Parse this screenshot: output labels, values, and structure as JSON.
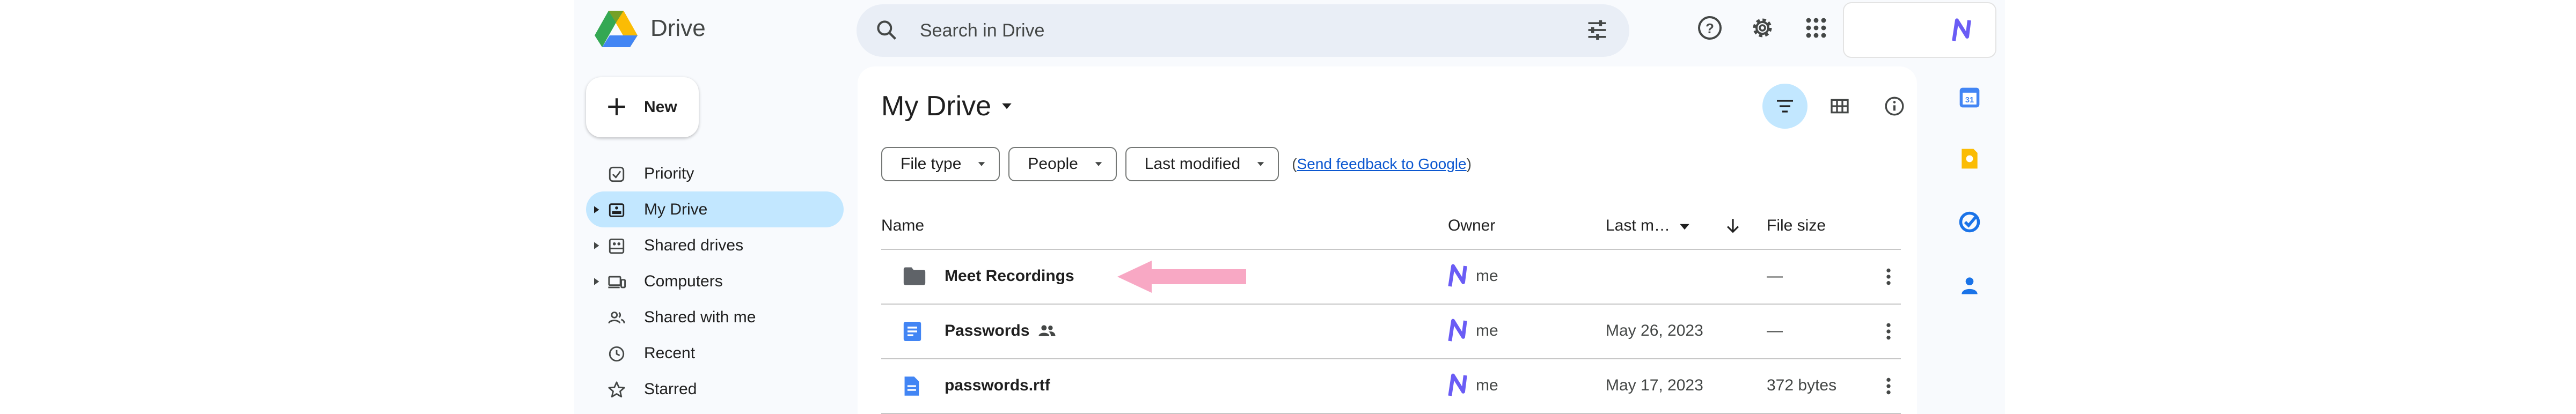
{
  "app": {
    "title": "Drive"
  },
  "search": {
    "placeholder": "Search in Drive"
  },
  "sidebar": {
    "new_label": "New",
    "items": [
      {
        "label": "Priority"
      },
      {
        "label": "My Drive"
      },
      {
        "label": "Shared drives"
      },
      {
        "label": "Computers"
      },
      {
        "label": "Shared with me"
      },
      {
        "label": "Recent"
      },
      {
        "label": "Starred"
      }
    ]
  },
  "main": {
    "title": "My Drive",
    "filters": [
      {
        "label": "File type"
      },
      {
        "label": "People"
      },
      {
        "label": "Last modified"
      }
    ],
    "feedback": {
      "open": "(",
      "link": "Send feedback to Google",
      "close": ")"
    },
    "columns": {
      "name": "Name",
      "owner": "Owner",
      "modified": "Last m…",
      "size": "File size"
    },
    "rows": [
      {
        "name": "Meet Recordings",
        "owner": "me",
        "modified": "",
        "size": "—",
        "type": "folder"
      },
      {
        "name": "Passwords",
        "owner": "me",
        "modified": "May 26, 2023",
        "size": "—",
        "type": "doc",
        "shared": true
      },
      {
        "name": "passwords.rtf",
        "owner": "me",
        "modified": "May 17, 2023",
        "size": "372 bytes",
        "type": "rtf"
      }
    ]
  },
  "colors": {
    "accent": "#c2e7ff",
    "highlight_arrow": "#f8a8c4",
    "background": "#f8fafd"
  }
}
